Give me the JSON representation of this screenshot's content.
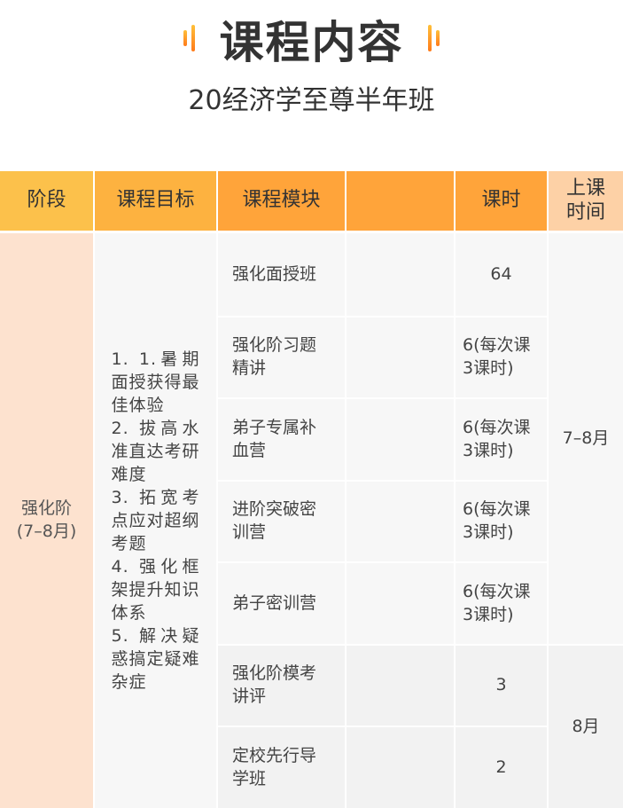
{
  "title": "课程内容",
  "subtitle": "20经济学至尊半年班",
  "header": {
    "stage": "阶段",
    "goal": "课程目标",
    "module": "课程模块",
    "empty": "",
    "hours": "课时",
    "time": "上课时间"
  },
  "stage": {
    "name": "强化阶",
    "period": "(7–8月)"
  },
  "goals": "1. 1.暑期面授获得最佳体验\n2. 拔高水准直达考研难度\n3. 拓宽考点应对超纲考题\n4. 强化框架提升知识体系\n5. 解决疑惑搞定疑难杂症",
  "modules": [
    {
      "name": "强化面授班",
      "hours": "64"
    },
    {
      "name": "强化阶习题精讲",
      "hours": "6(每次课3课时)"
    },
    {
      "name": "弟子专属补血营",
      "hours": "6(每次课3课时)"
    },
    {
      "name": "进阶突破密训营",
      "hours": "6(每次课3课时)"
    },
    {
      "name": "弟子密训营",
      "hours": "6(每次课3课时)"
    },
    {
      "name": "强化阶模考讲评",
      "hours": "3"
    },
    {
      "name": "定校先行导学班",
      "hours": "2"
    }
  ],
  "times": [
    "7–8月",
    "8月"
  ],
  "colors": {
    "header_light": "#fcc14b",
    "header_orange": "#ffa43a",
    "header_peach": "#fdd1a6",
    "stage_bg": "#fde2cf",
    "cell_bg": "#f7f7f7",
    "cell_bg_alt": "#f2f2f2"
  }
}
